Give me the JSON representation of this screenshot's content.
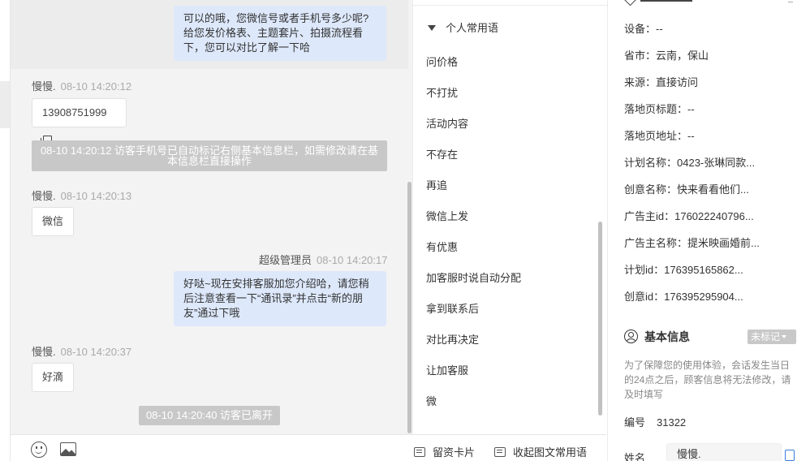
{
  "chat": {
    "messages": [
      {
        "type": "agent_bubble",
        "text_lines": [
          "可以的哦，您微信号或者手机号多少呢?",
          "给您发价格表、主题套片、拍摄流程看",
          "下，您可以对比了解一下哈"
        ]
      },
      {
        "type": "visitor",
        "sender": "慢慢.",
        "time": "08-10 14:20:12",
        "text": "13908751999"
      },
      {
        "type": "system",
        "text_lines": [
          "08-10 14:20:12 访客手机号已自动标记右侧基本信息栏，如需修改请在基",
          "本信息栏直接操作"
        ]
      },
      {
        "type": "visitor",
        "sender": "慢慢.",
        "time": "08-10 14:20:13",
        "text": "微信"
      },
      {
        "type": "agent",
        "sender": "超级管理员",
        "time": "08-10 14:20:17",
        "text_lines": [
          "好哒~现在安排客服加您介绍哈，请您稍",
          "后注意查看一下“通讯录”并点击“新的朋",
          "友”通过下哦"
        ]
      },
      {
        "type": "visitor",
        "sender": "慢慢.",
        "time": "08-10 14:20:37",
        "text": "好滴"
      },
      {
        "type": "system",
        "text": "08-10 14:20:40 访客已离开"
      }
    ]
  },
  "toolbar": {
    "emoji_icon": "emoji-icon",
    "image_icon": "image-icon",
    "card_label": "留资卡片",
    "collapse_label": "收起图文常用语"
  },
  "phrases": {
    "header": "个人常用语",
    "items": [
      "问价格",
      "不打扰",
      "活动内容",
      "不存在",
      "再追",
      "微信上发",
      "有优惠",
      "加客服时说自动分配",
      "拿到联系后",
      "对比再决定",
      "让加客服",
      "微"
    ]
  },
  "info": {
    "rows": [
      "设备：--",
      "省市：云南，保山",
      "来源：直接访问",
      "落地页标题：--",
      "落地页地址：--",
      "计划名称：0423-张琳同款...",
      "创意名称：快来看看他们...",
      "广告主id：176022240796...",
      "广告主名称：提米映画婚前...",
      "计划id：176395165862...",
      "创意id：176395295904..."
    ],
    "basic_title": "基本信息",
    "tag_label": "未标记",
    "hint": "为了保障您的使用体验，会话发生当日的24点之后，顾客信息将无法修改，请及时填写",
    "id_label": "编号",
    "id_value": "31322",
    "name_label": "姓名",
    "name_value": "慢慢."
  }
}
